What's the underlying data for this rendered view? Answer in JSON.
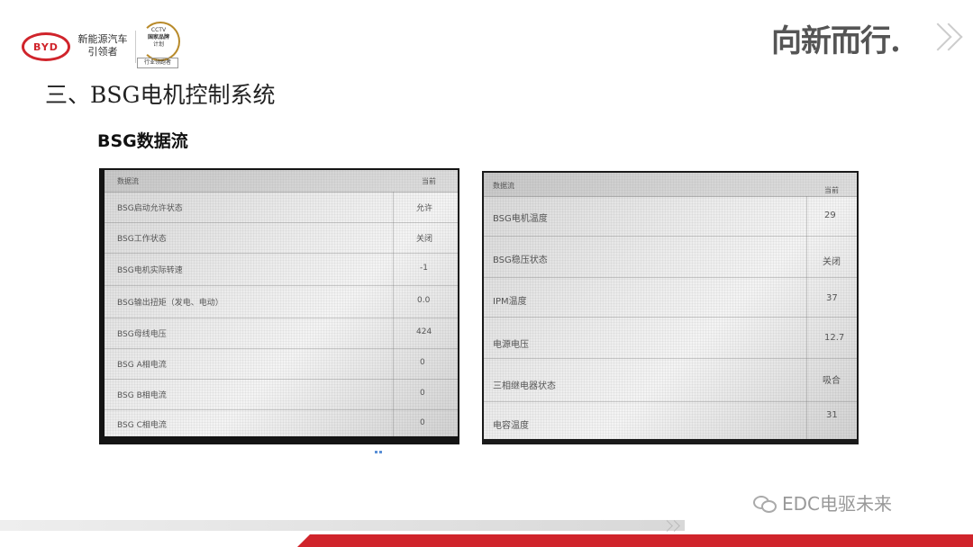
{
  "header": {
    "logo": "BYD",
    "brand_line1": "新能源汽车",
    "brand_line2": "引领者",
    "badge_lines": [
      "CCTV",
      "国家品牌",
      "计划"
    ],
    "badge_tag": "行业领跑者",
    "slogan": "向新而行."
  },
  "title": "三、BSG电机控制系统",
  "subtitle": "BSG数据流",
  "screen_left": {
    "header_name": "数据流",
    "header_value": "当前",
    "rows": [
      {
        "label": "BSG启动允许状态",
        "value": "允许"
      },
      {
        "label": "BSG工作状态",
        "value": "关闭"
      },
      {
        "label": "BSG电机实际转速",
        "value": "-1"
      },
      {
        "label": "BSG输出扭矩（发电、电动）",
        "value": "0.0"
      },
      {
        "label": "BSG母线电压",
        "value": "424"
      },
      {
        "label": "BSG A相电流",
        "value": "0"
      },
      {
        "label": "BSG B相电流",
        "value": "0"
      },
      {
        "label": "BSG C相电流",
        "value": "0"
      }
    ]
  },
  "screen_right": {
    "header_name": "数据流",
    "header_value": "当前",
    "rows": [
      {
        "label": "BSG电机温度",
        "value": "29"
      },
      {
        "label": "BSG稳压状态",
        "value": "关闭"
      },
      {
        "label": "IPM温度",
        "value": "37"
      },
      {
        "label": "电源电压",
        "value": "12.7"
      },
      {
        "label": "三相继电器状态",
        "value": "吸合"
      },
      {
        "label": "电容温度",
        "value": "31"
      }
    ]
  },
  "watermark": "EDC电驱未来",
  "colors": {
    "brand_red": "#d0242b",
    "gold": "#b88a2a"
  }
}
